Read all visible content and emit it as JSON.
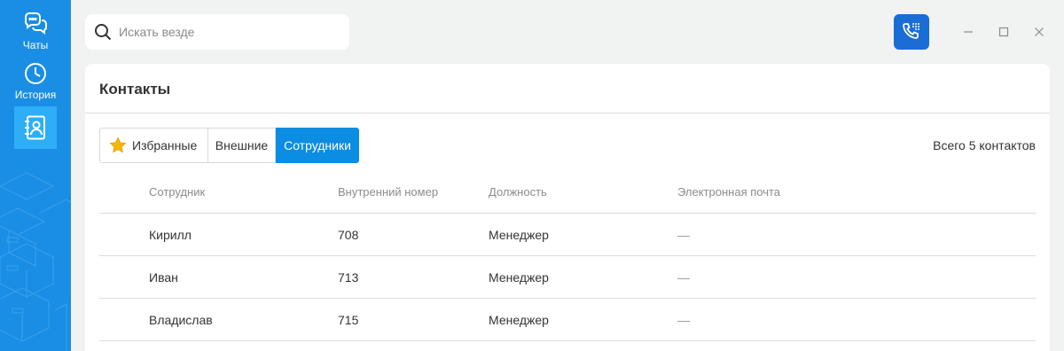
{
  "sidebar": {
    "items": [
      {
        "label": "Чаты",
        "icon": "chat-bubbles-icon"
      },
      {
        "label": "История",
        "icon": "clock-icon"
      },
      {
        "label": "",
        "icon": "contacts-book-icon",
        "active": true
      }
    ]
  },
  "search": {
    "placeholder": "Искать везде",
    "value": ""
  },
  "panel": {
    "title": "Контакты",
    "tabs": [
      {
        "label": "Избранные",
        "icon": "star-icon"
      },
      {
        "label": "Внешние"
      },
      {
        "label": "Сотрудники",
        "active": true
      }
    ],
    "total": "Всего 5 контактов",
    "columns": [
      "Сотрудник",
      "Внутренний номер",
      "Должность",
      "Электронная почта"
    ],
    "rows": [
      {
        "name": "Кирилл",
        "ext": "708",
        "position": "Менеджер",
        "email": "—"
      },
      {
        "name": "Иван",
        "ext": "713",
        "position": "Менеджер",
        "email": "—"
      },
      {
        "name": "Владислав",
        "ext": "715",
        "position": "Менеджер",
        "email": "—"
      }
    ]
  },
  "colors": {
    "sidebar": "#1a8ee4",
    "active_tab": "#0a8de3",
    "dialer": "#1b6dd6",
    "star": "#f5b800"
  }
}
